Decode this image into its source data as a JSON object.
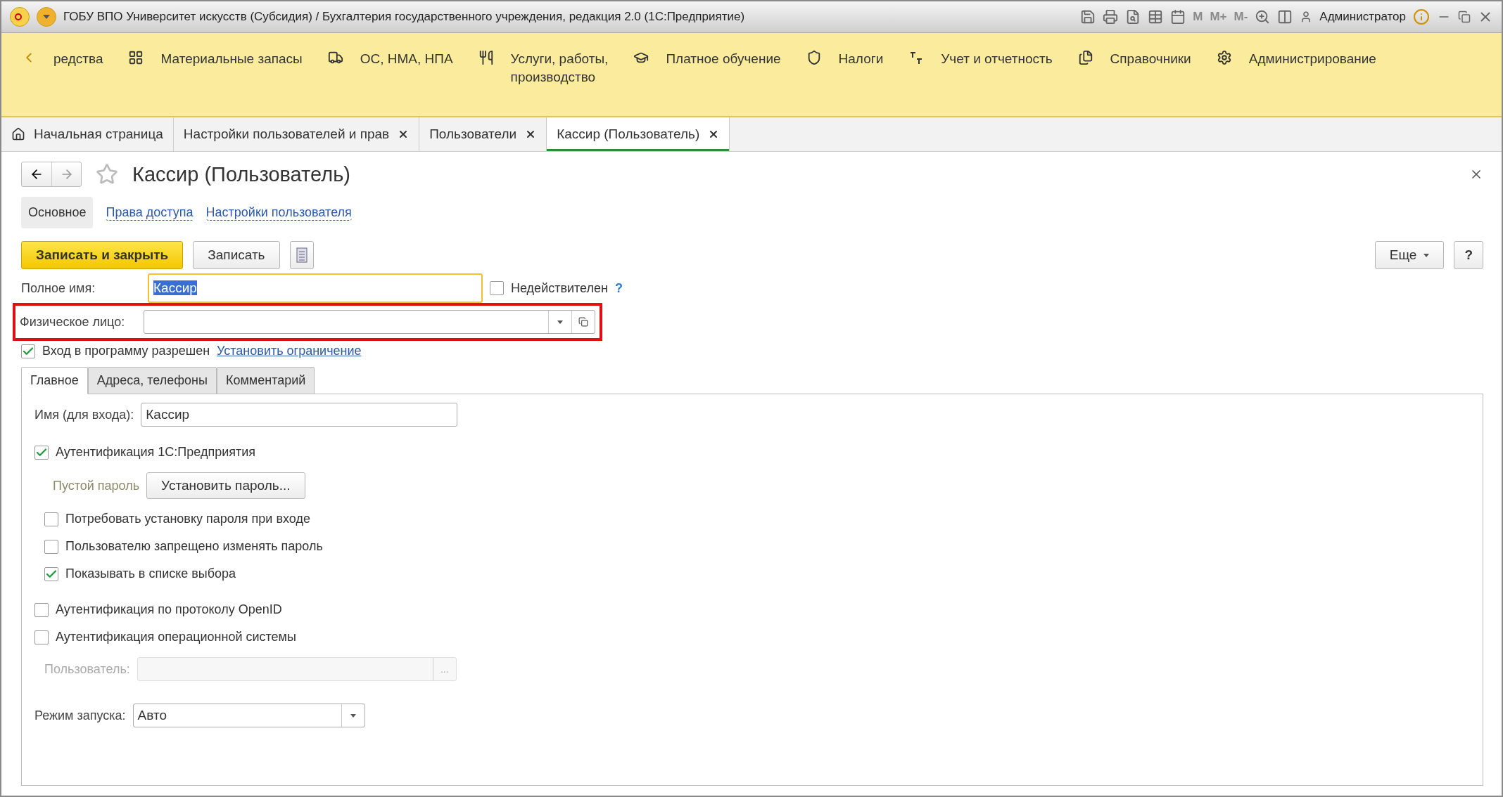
{
  "window": {
    "title": "ГОБУ ВПО Университет искусств (Субсидия) / Бухгалтерия государственного учреждения, редакция 2.0  (1С:Предприятие)",
    "memory_buttons": [
      "M",
      "M+",
      "M-"
    ],
    "user": "Администратор"
  },
  "sections": [
    {
      "label": "редства"
    },
    {
      "label": "Материальные запасы"
    },
    {
      "label": "ОС, НМА, НПА"
    },
    {
      "label": "Услуги, работы,\nпроизводство"
    },
    {
      "label": "Платное обучение"
    },
    {
      "label": "Налоги"
    },
    {
      "label": "Учет и отчетность"
    },
    {
      "label": "Справочники"
    },
    {
      "label": "Администрирование"
    }
  ],
  "open_tabs": [
    {
      "label": "Начальная страница",
      "closable": false,
      "selected": false
    },
    {
      "label": "Настройки пользователей и прав",
      "closable": true,
      "selected": false
    },
    {
      "label": "Пользователи",
      "closable": true,
      "selected": false
    },
    {
      "label": "Кассир (Пользователь)",
      "closable": true,
      "selected": true
    }
  ],
  "form": {
    "title": "Кассир (Пользователь)",
    "favorite": false,
    "views": [
      {
        "label": "Основное",
        "selected": true
      },
      {
        "label": "Права доступа",
        "selected": false
      },
      {
        "label": "Настройки пользователя",
        "selected": false
      }
    ],
    "save_close": "Записать и закрыть",
    "save": "Записать",
    "more": "Еще",
    "help": "?",
    "full_name": {
      "label": "Полное имя:",
      "value": "Кассир"
    },
    "invalid": {
      "label": "Недействителен",
      "checked": false,
      "hint": "?"
    },
    "person": {
      "label": "Физическое лицо:",
      "highlighted": true
    },
    "login_allowed": {
      "label": "Вход в программу разрешен",
      "checked": true,
      "link": "Установить ограничение"
    },
    "tabs": [
      {
        "label": "Главное",
        "selected": true
      },
      {
        "label": "Адреса, телефоны",
        "selected": false
      },
      {
        "label": "Комментарий",
        "selected": false
      }
    ],
    "login_name": {
      "label": "Имя (для входа):",
      "value": "Кассир"
    },
    "auth_1c": {
      "label": "Аутентификация 1С:Предприятия",
      "checked": true
    },
    "password_state": "Пустой пароль",
    "set_password": "Установить пароль...",
    "password_options": [
      {
        "label": "Потребовать установку пароля при входе",
        "checked": false
      },
      {
        "label": "Пользователю запрещено изменять пароль",
        "checked": false
      },
      {
        "label": "Показывать в списке выбора",
        "checked": true
      }
    ],
    "auth_other": [
      {
        "label": "Аутентификация по протоколу OpenID",
        "checked": false
      },
      {
        "label": "Аутентификация операционной системы",
        "checked": false
      }
    ],
    "os_user": {
      "label": "Пользователь:",
      "disabled": true,
      "button": "..."
    },
    "launch_mode": {
      "label": "Режим запуска:",
      "value": "Авто"
    }
  }
}
